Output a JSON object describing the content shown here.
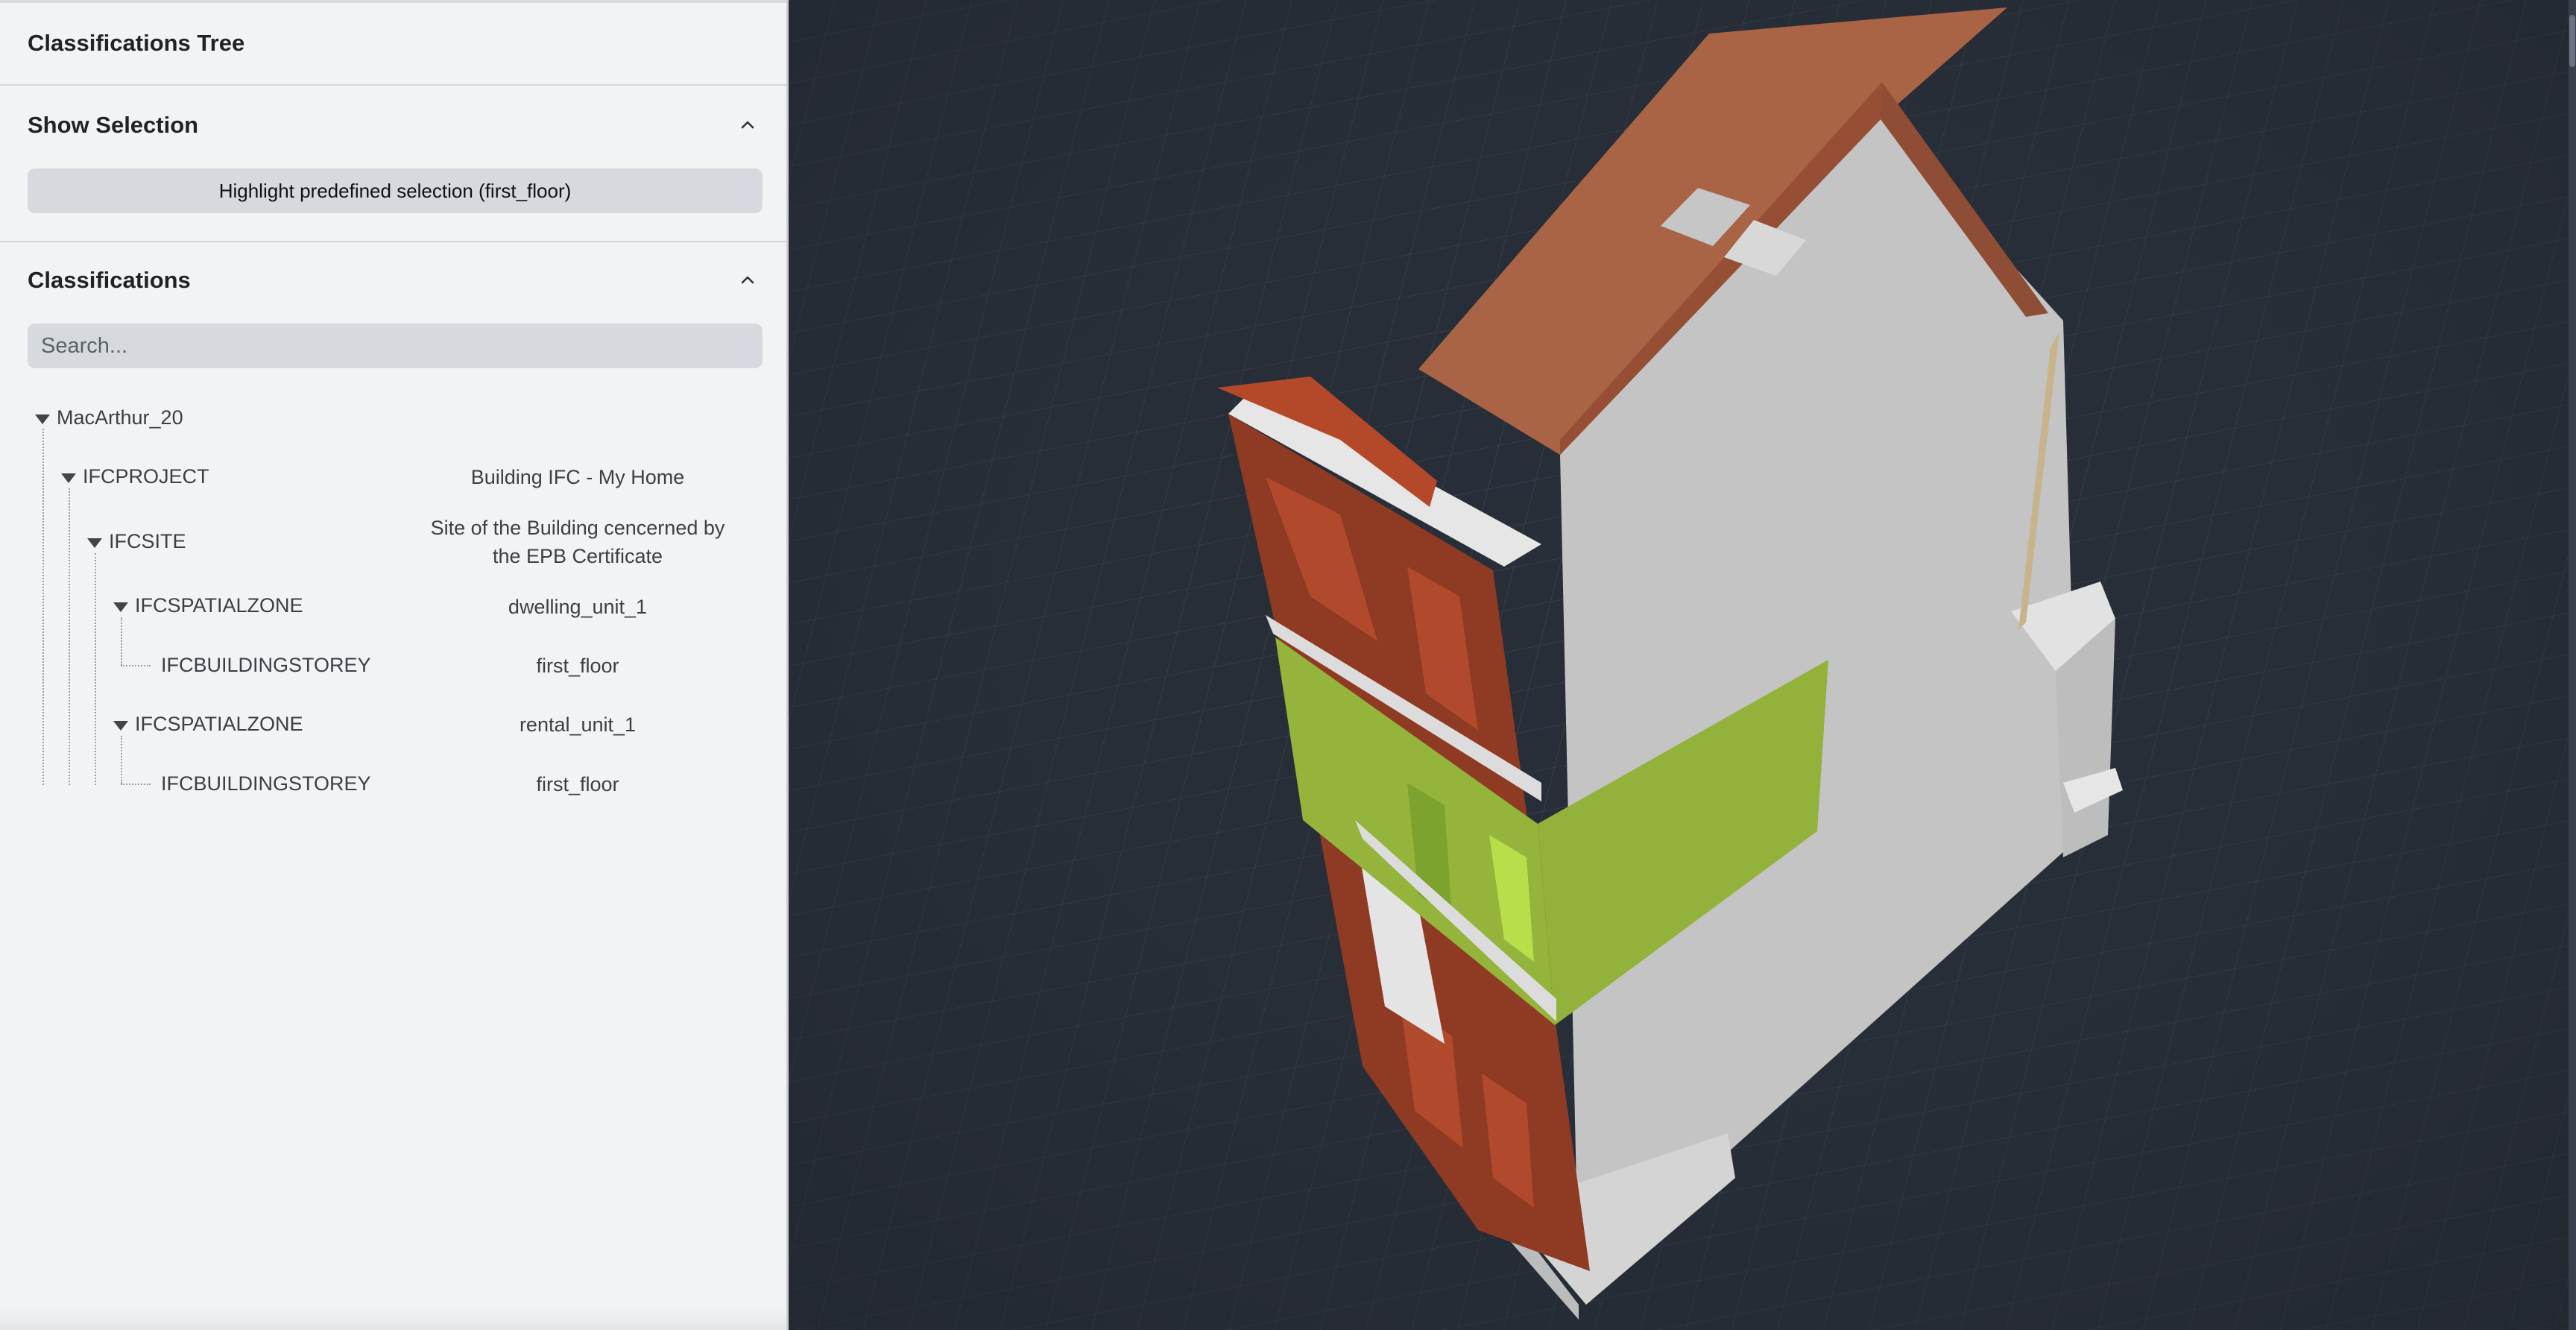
{
  "panel": {
    "title": "Classifications Tree",
    "show_selection": {
      "title": "Show Selection",
      "button_label": "Highlight predefined selection (first_floor)"
    },
    "classifications": {
      "title": "Classifications",
      "search_placeholder": "Search..."
    },
    "tree": [
      {
        "label": "MacArthur_20",
        "value": "",
        "level": 0,
        "expanded": true
      },
      {
        "label": "IFCPROJECT",
        "value": "Building IFC - My Home",
        "level": 1,
        "expanded": true
      },
      {
        "label": "IFCSITE",
        "value": "Site of the Building cencerned by the EPB Certificate",
        "level": 2,
        "expanded": true
      },
      {
        "label": "IFCSPATIALZONE",
        "value": "dwelling_unit_1",
        "level": 3,
        "expanded": true
      },
      {
        "label": "IFCBUILDINGSTOREY",
        "value": "first_floor",
        "level": 4,
        "expanded": false
      },
      {
        "label": "IFCSPATIALZONE",
        "value": "rental_unit_1",
        "level": 3,
        "expanded": true
      },
      {
        "label": "IFCBUILDINGSTOREY",
        "value": "first_floor",
        "level": 4,
        "expanded": false
      }
    ]
  },
  "viewer": {
    "colors": {
      "background": "#282e38",
      "roof": "#a86444",
      "brick": "#8f3a22",
      "wall": "#c3c3c3",
      "highlight": "#94b43c",
      "trim": "#c8b48c"
    }
  }
}
